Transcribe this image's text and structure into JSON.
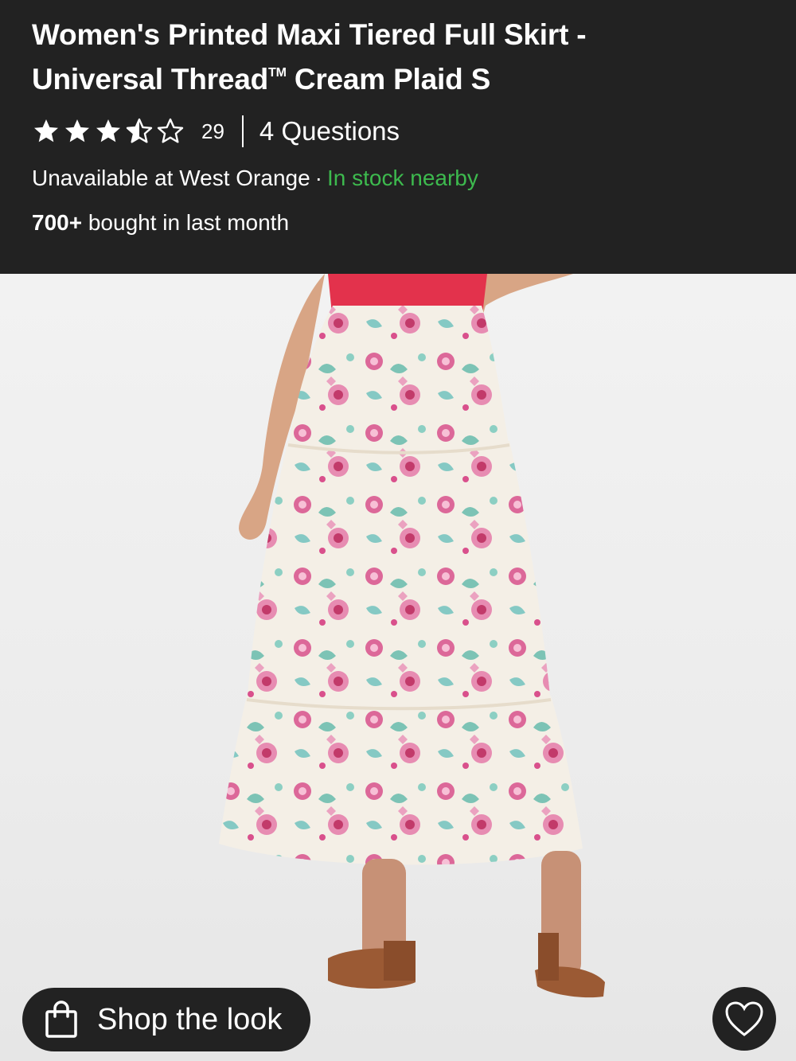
{
  "product": {
    "title_line1": "Women's Printed Maxi Tiered Full Skirt -",
    "title_line2_pre": "Universal Thread",
    "title_tm": "TM",
    "title_line2_post": " Cream Plaid S",
    "rating": 3.5,
    "rating_max": 5,
    "review_count": "29",
    "questions": "4 Questions",
    "availability_text": "Unavailable at West Orange",
    "availability_sep": "·",
    "in_stock_text": "In stock nearby",
    "bought_count": "700+",
    "bought_text": " bought in last month"
  },
  "actions": {
    "shop_the_look": "Shop the look"
  },
  "colors": {
    "header_bg": "#222222",
    "in_stock": "#3dba4e",
    "photo_bg": "#efefef"
  },
  "icons": {
    "star": "star-icon",
    "bag": "shopping-bag-icon",
    "heart": "heart-icon"
  }
}
